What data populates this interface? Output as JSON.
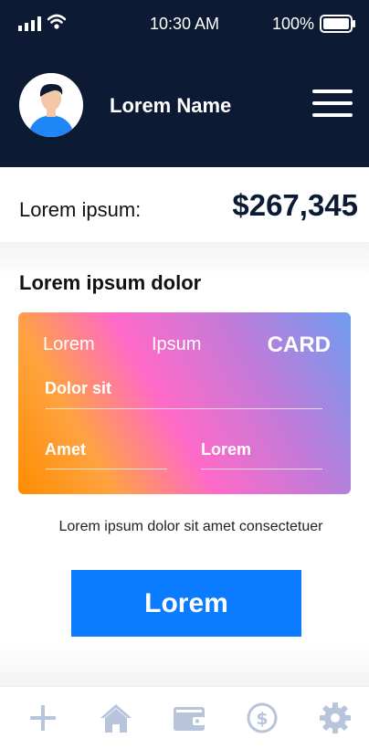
{
  "status_bar": {
    "time": "10:30 AM",
    "battery": "100%"
  },
  "header": {
    "user_name": "Lorem Name"
  },
  "balance": {
    "label": "Lorem ipsum:",
    "value": "$267,345"
  },
  "section": {
    "title": "Lorem ipsum dolor"
  },
  "card": {
    "header_left": "Lorem",
    "header_middle": "Ipsum",
    "header_right": "CARD",
    "field_1": "Dolor sit",
    "field_2": "Amet",
    "field_3": "Lorem"
  },
  "caption": "Lorem ipsum dolor sit amet consectetuer",
  "cta": {
    "label": "Lorem"
  },
  "tabbar": {
    "icons": [
      "plus-icon",
      "home-icon",
      "wallet-icon",
      "dollar-icon",
      "gear-icon"
    ]
  },
  "colors": {
    "header_bg": "#0c1a33",
    "accent": "#0b7bff",
    "tab_icon": "#b8c3dc"
  }
}
